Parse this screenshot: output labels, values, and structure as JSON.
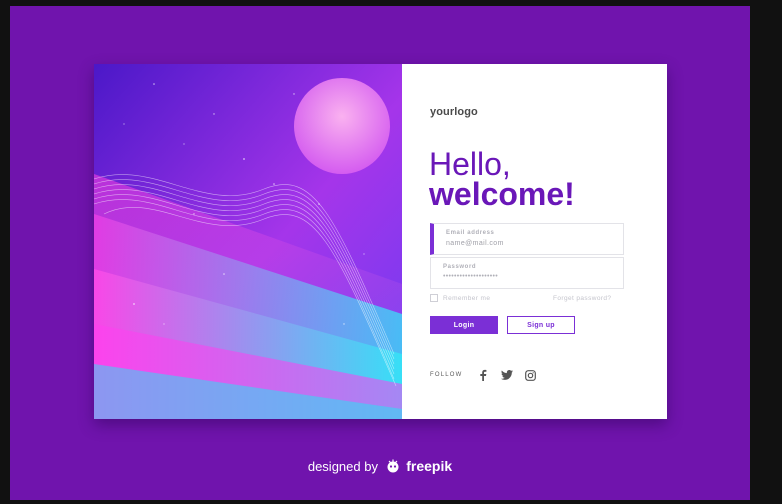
{
  "logo": "yourlogo",
  "heading": {
    "line1": "Hello,",
    "line2": "welcome!"
  },
  "email": {
    "label": "Email address",
    "placeholder": "name@mail.com"
  },
  "password": {
    "label": "Password",
    "mask": "••••••••••••••••••••"
  },
  "remember_label": "Remember me",
  "forgot_label": "Forget password?",
  "buttons": {
    "login": "Login",
    "signup": "Sign up"
  },
  "follow": {
    "label": "FOLLOW",
    "icons": [
      "facebook-icon",
      "twitter-icon",
      "instagram-icon"
    ]
  },
  "credit": {
    "prefix": "designed by",
    "brand": "freepik"
  },
  "colors": {
    "accent": "#7b2fd6",
    "frame": "#7014ad",
    "heading": "#6a17b8"
  }
}
